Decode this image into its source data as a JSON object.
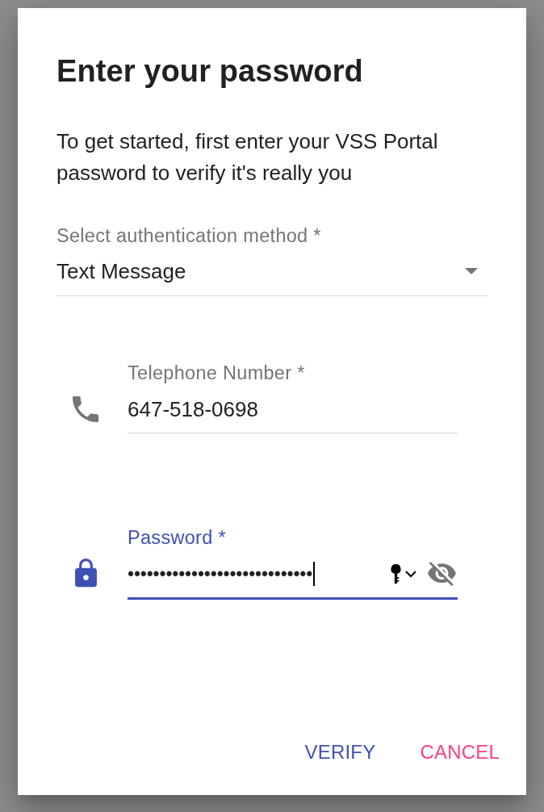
{
  "dialog": {
    "title": "Enter your password",
    "description": "To get started, first enter your VSS Portal password to verify it's really you"
  },
  "method_select": {
    "label": "Select authentication method *",
    "value": "Text Message"
  },
  "fields": [
    {
      "kind": "phone",
      "label": "Telephone Number *",
      "value": "647-518-0698",
      "focused": false
    },
    {
      "kind": "password",
      "label": "Password *",
      "value": "•••••••••••••••••••••••••••••",
      "focused": true,
      "revealed": false
    }
  ],
  "buttons": [
    {
      "label": "VERIFY",
      "kind": "primary"
    },
    {
      "label": "CANCEL",
      "kind": "secondary"
    }
  ]
}
